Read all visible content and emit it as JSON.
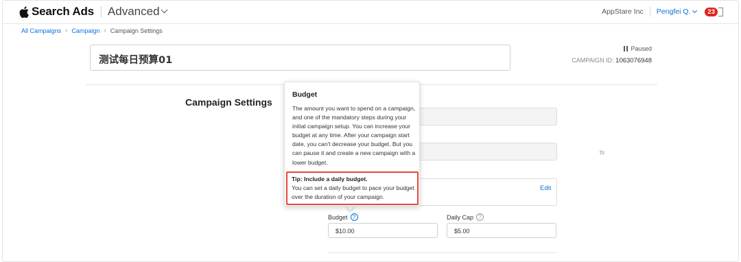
{
  "header": {
    "brand": "Search Ads",
    "mode": "Advanced",
    "org": "AppStare Inc",
    "user": "Pengfei Q.",
    "notification_count": "23"
  },
  "breadcrumb": {
    "items": [
      "All Campaigns",
      "Campaign"
    ],
    "current": "Campaign Settings"
  },
  "campaign": {
    "name": "测试每日预算01",
    "status": "Paused",
    "id_label": "CAMPAIGN ID:",
    "id_value": "1063076948"
  },
  "section": {
    "title": "Campaign Settings"
  },
  "form": {
    "partial_field_text": "ts",
    "edit_label": "Edit",
    "budget_label": "Budget",
    "budget_value": "$10.00",
    "daily_cap_label": "Daily Cap",
    "daily_cap_value": "$5.00",
    "help_glyph": "?"
  },
  "tooltip": {
    "title": "Budget",
    "body": "The amount you want to spend on a campaign, and one of the mandatory steps during your initial campaign setup. You can increase your budget at any time. After your campaign start date, you can't decrease your budget. But you can pause it and create a new campaign with a lower budget.",
    "tip_title": "Tip: Include a daily budget.",
    "tip_body": "You can set a daily budget to pace your budget over the duration of your campaign."
  },
  "colors": {
    "link": "#0a70d9",
    "badge": "#e0241b",
    "highlight": "#e5463b"
  }
}
